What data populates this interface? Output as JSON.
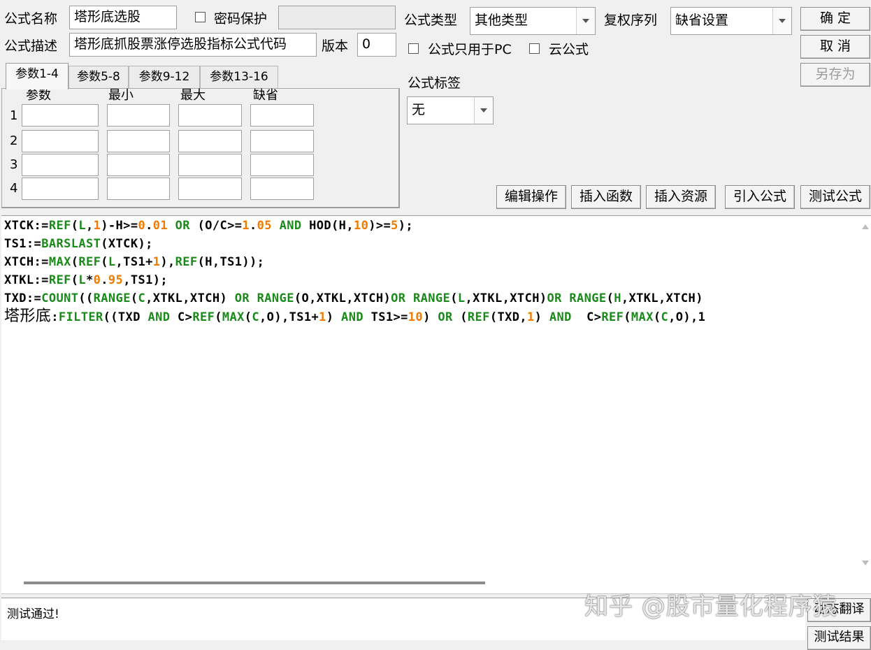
{
  "form": {
    "name_label": "公式名称",
    "name_value": "塔形底选股",
    "password_label": "密码保护",
    "password_value": "",
    "desc_label": "公式描述",
    "desc_value": "塔形底抓股票涨停选股指标公式代码",
    "version_label": "版本",
    "version_value": "0",
    "type_label": "公式类型",
    "type_value": "其他类型",
    "rights_label": "复权序列",
    "rights_value": "缺省设置",
    "pc_only_label": "公式只用于PC",
    "cloud_label": "云公式",
    "tag_label": "公式标签",
    "tag_value": "无"
  },
  "buttons": {
    "ok": "确 定",
    "cancel": "取 消",
    "save_as": "另存为",
    "edit_ops": "编辑操作",
    "insert_func": "插入函数",
    "insert_res": "插入资源",
    "import_formula": "引入公式",
    "test_formula": "测试公式",
    "translate": "动态翻译",
    "test_result": "测试结果"
  },
  "tabs": [
    "参数1-4",
    "参数5-8",
    "参数9-12",
    "参数13-16"
  ],
  "params": {
    "headers": [
      "参数",
      "最小",
      "最大",
      "缺省"
    ],
    "rows": [
      "1",
      "2",
      "3",
      "4"
    ]
  },
  "code_lines": [
    [
      [
        "k",
        "XTCK:="
      ],
      [
        "f",
        "REF"
      ],
      [
        "k",
        "("
      ],
      [
        "f",
        "L"
      ],
      [
        "k",
        ","
      ],
      [
        "n",
        "1"
      ],
      [
        "k",
        ")-H>="
      ],
      [
        "n",
        "0"
      ],
      [
        "k",
        "."
      ],
      [
        "n",
        "01"
      ],
      [
        "o",
        " OR "
      ],
      [
        "k",
        "(O/C>="
      ],
      [
        "n",
        "1"
      ],
      [
        "k",
        "."
      ],
      [
        "n",
        "05"
      ],
      [
        "o",
        " AND "
      ],
      [
        "k",
        "HOD(H,"
      ],
      [
        "n",
        "10"
      ],
      [
        "k",
        ")>="
      ],
      [
        "n",
        "5"
      ],
      [
        "k",
        ");"
      ]
    ],
    [
      [
        "k",
        "TS1:="
      ],
      [
        "f",
        "BARSLAST"
      ],
      [
        "k",
        "(XTCK);"
      ]
    ],
    [
      [
        "k",
        "XTCH:="
      ],
      [
        "f",
        "MAX"
      ],
      [
        "k",
        "("
      ],
      [
        "f",
        "REF"
      ],
      [
        "k",
        "("
      ],
      [
        "f",
        "L"
      ],
      [
        "k",
        ",TS1+"
      ],
      [
        "n",
        "1"
      ],
      [
        "k",
        "),"
      ],
      [
        "f",
        "REF"
      ],
      [
        "k",
        "(H,TS1));"
      ]
    ],
    [
      [
        "k",
        "XTKL:="
      ],
      [
        "f",
        "REF"
      ],
      [
        "k",
        "("
      ],
      [
        "f",
        "L"
      ],
      [
        "k",
        "*"
      ],
      [
        "n",
        "0"
      ],
      [
        "k",
        "."
      ],
      [
        "n",
        "95"
      ],
      [
        "k",
        ",TS1);"
      ]
    ],
    [
      [
        "k",
        "TXD:="
      ],
      [
        "f",
        "COUNT"
      ],
      [
        "k",
        "(("
      ],
      [
        "f",
        "RANGE"
      ],
      [
        "k",
        "("
      ],
      [
        "f",
        "C"
      ],
      [
        "k",
        ",XTKL,XTCH)"
      ],
      [
        "o",
        " OR "
      ],
      [
        "f",
        "RANGE"
      ],
      [
        "k",
        "(O,XTKL,XTCH)"
      ],
      [
        "o",
        "OR "
      ],
      [
        "f",
        "RANGE"
      ],
      [
        "k",
        "("
      ],
      [
        "f",
        "L"
      ],
      [
        "k",
        ",XTKL,XTCH)"
      ],
      [
        "o",
        "OR "
      ],
      [
        "f",
        "RANGE"
      ],
      [
        "k",
        "("
      ],
      [
        "f",
        "H"
      ],
      [
        "k",
        ",XTKL,XTCH)"
      ]
    ],
    [
      [
        "cn",
        "塔形底"
      ],
      [
        "k",
        ":"
      ],
      [
        "f",
        "FILTER"
      ],
      [
        "k",
        "((TXD"
      ],
      [
        "o",
        " AND "
      ],
      [
        "k",
        "C>"
      ],
      [
        "f",
        "REF"
      ],
      [
        "k",
        "("
      ],
      [
        "f",
        "MAX"
      ],
      [
        "k",
        "("
      ],
      [
        "f",
        "C"
      ],
      [
        "k",
        ",O),TS1+"
      ],
      [
        "n",
        "1"
      ],
      [
        "k",
        ")"
      ],
      [
        "o",
        " AND "
      ],
      [
        "k",
        "TS1>="
      ],
      [
        "n",
        "10"
      ],
      [
        "k",
        ")"
      ],
      [
        "o",
        " OR "
      ],
      [
        "k",
        "("
      ],
      [
        "f",
        "REF"
      ],
      [
        "k",
        "(TXD,"
      ],
      [
        "n",
        "1"
      ],
      [
        "k",
        ")"
      ],
      [
        "o",
        " AND  "
      ],
      [
        "k",
        "C>"
      ],
      [
        "f",
        "REF"
      ],
      [
        "k",
        "("
      ],
      [
        "f",
        "MAX"
      ],
      [
        "k",
        "("
      ],
      [
        "f",
        "C"
      ],
      [
        "k",
        ",O),1"
      ]
    ]
  ],
  "status_text": "测试通过!",
  "watermark": "知乎 @股市量化程序猿"
}
